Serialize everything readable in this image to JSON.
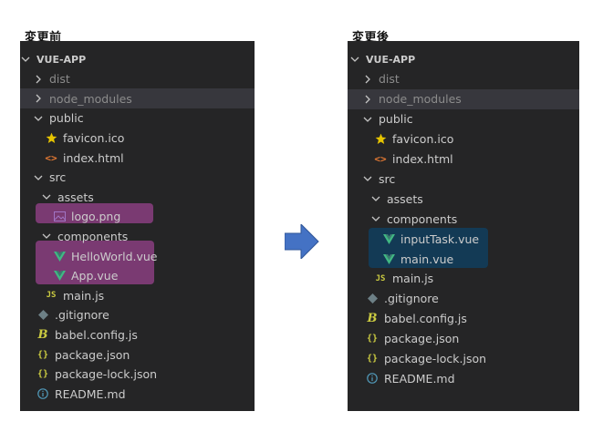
{
  "captions": {
    "before": "変更前",
    "after": "変更後"
  },
  "colors": {
    "panel_bg": "#252526",
    "hover_bg": "#37373d",
    "highlight_before": "#7a3a72",
    "highlight_after": "#133a55",
    "arrow": "#4472c4",
    "vue_icon": "#41b883",
    "star": "#e6c400",
    "html_icon": "#e37933",
    "js_icon": "#cbcb41",
    "json_icon": "#cbcb41",
    "info_icon": "#519aba",
    "git_icon": "#6d8086"
  },
  "before_tree": {
    "root": "VUE-APP",
    "items": [
      {
        "label": "dist",
        "type": "folder-collapsed",
        "dim": true
      },
      {
        "label": "node_modules",
        "type": "folder-collapsed",
        "dim": true,
        "hover": true
      },
      {
        "label": "public",
        "type": "folder-expanded"
      },
      {
        "label": "favicon.ico",
        "type": "file",
        "icon": "star-icon"
      },
      {
        "label": "index.html",
        "type": "file",
        "icon": "html-icon"
      },
      {
        "label": "src",
        "type": "folder-expanded"
      },
      {
        "label": "assets",
        "type": "folder-expanded"
      },
      {
        "label": "logo.png",
        "type": "file",
        "icon": "image-icon"
      },
      {
        "label": "components",
        "type": "folder-expanded"
      },
      {
        "label": "HelloWorld.vue",
        "type": "file",
        "icon": "vue-icon"
      },
      {
        "label": "App.vue",
        "type": "file",
        "icon": "vue-icon"
      },
      {
        "label": "main.js",
        "type": "file",
        "icon": "js-icon"
      },
      {
        "label": ".gitignore",
        "type": "file",
        "icon": "git-icon"
      },
      {
        "label": "babel.config.js",
        "type": "file",
        "icon": "babel-icon"
      },
      {
        "label": "package.json",
        "type": "file",
        "icon": "json-icon"
      },
      {
        "label": "package-lock.json",
        "type": "file",
        "icon": "json-icon"
      },
      {
        "label": "README.md",
        "type": "file",
        "icon": "info-icon"
      }
    ]
  },
  "after_tree": {
    "root": "VUE-APP",
    "items": [
      {
        "label": "dist",
        "type": "folder-collapsed",
        "dim": true
      },
      {
        "label": "node_modules",
        "type": "folder-collapsed",
        "dim": true,
        "hover": true
      },
      {
        "label": "public",
        "type": "folder-expanded"
      },
      {
        "label": "favicon.ico",
        "type": "file",
        "icon": "star-icon"
      },
      {
        "label": "index.html",
        "type": "file",
        "icon": "html-icon"
      },
      {
        "label": "src",
        "type": "folder-expanded"
      },
      {
        "label": "assets",
        "type": "folder-expanded"
      },
      {
        "label": "components",
        "type": "folder-expanded"
      },
      {
        "label": "inputTask.vue",
        "type": "file",
        "icon": "vue-icon"
      },
      {
        "label": "main.vue",
        "type": "file",
        "icon": "vue-icon"
      },
      {
        "label": "main.js",
        "type": "file",
        "icon": "js-icon"
      },
      {
        "label": ".gitignore",
        "type": "file",
        "icon": "git-icon"
      },
      {
        "label": "babel.config.js",
        "type": "file",
        "icon": "babel-icon"
      },
      {
        "label": "package.json",
        "type": "file",
        "icon": "json-icon"
      },
      {
        "label": "package-lock.json",
        "type": "file",
        "icon": "json-icon"
      },
      {
        "label": "README.md",
        "type": "file",
        "icon": "info-icon"
      }
    ]
  }
}
